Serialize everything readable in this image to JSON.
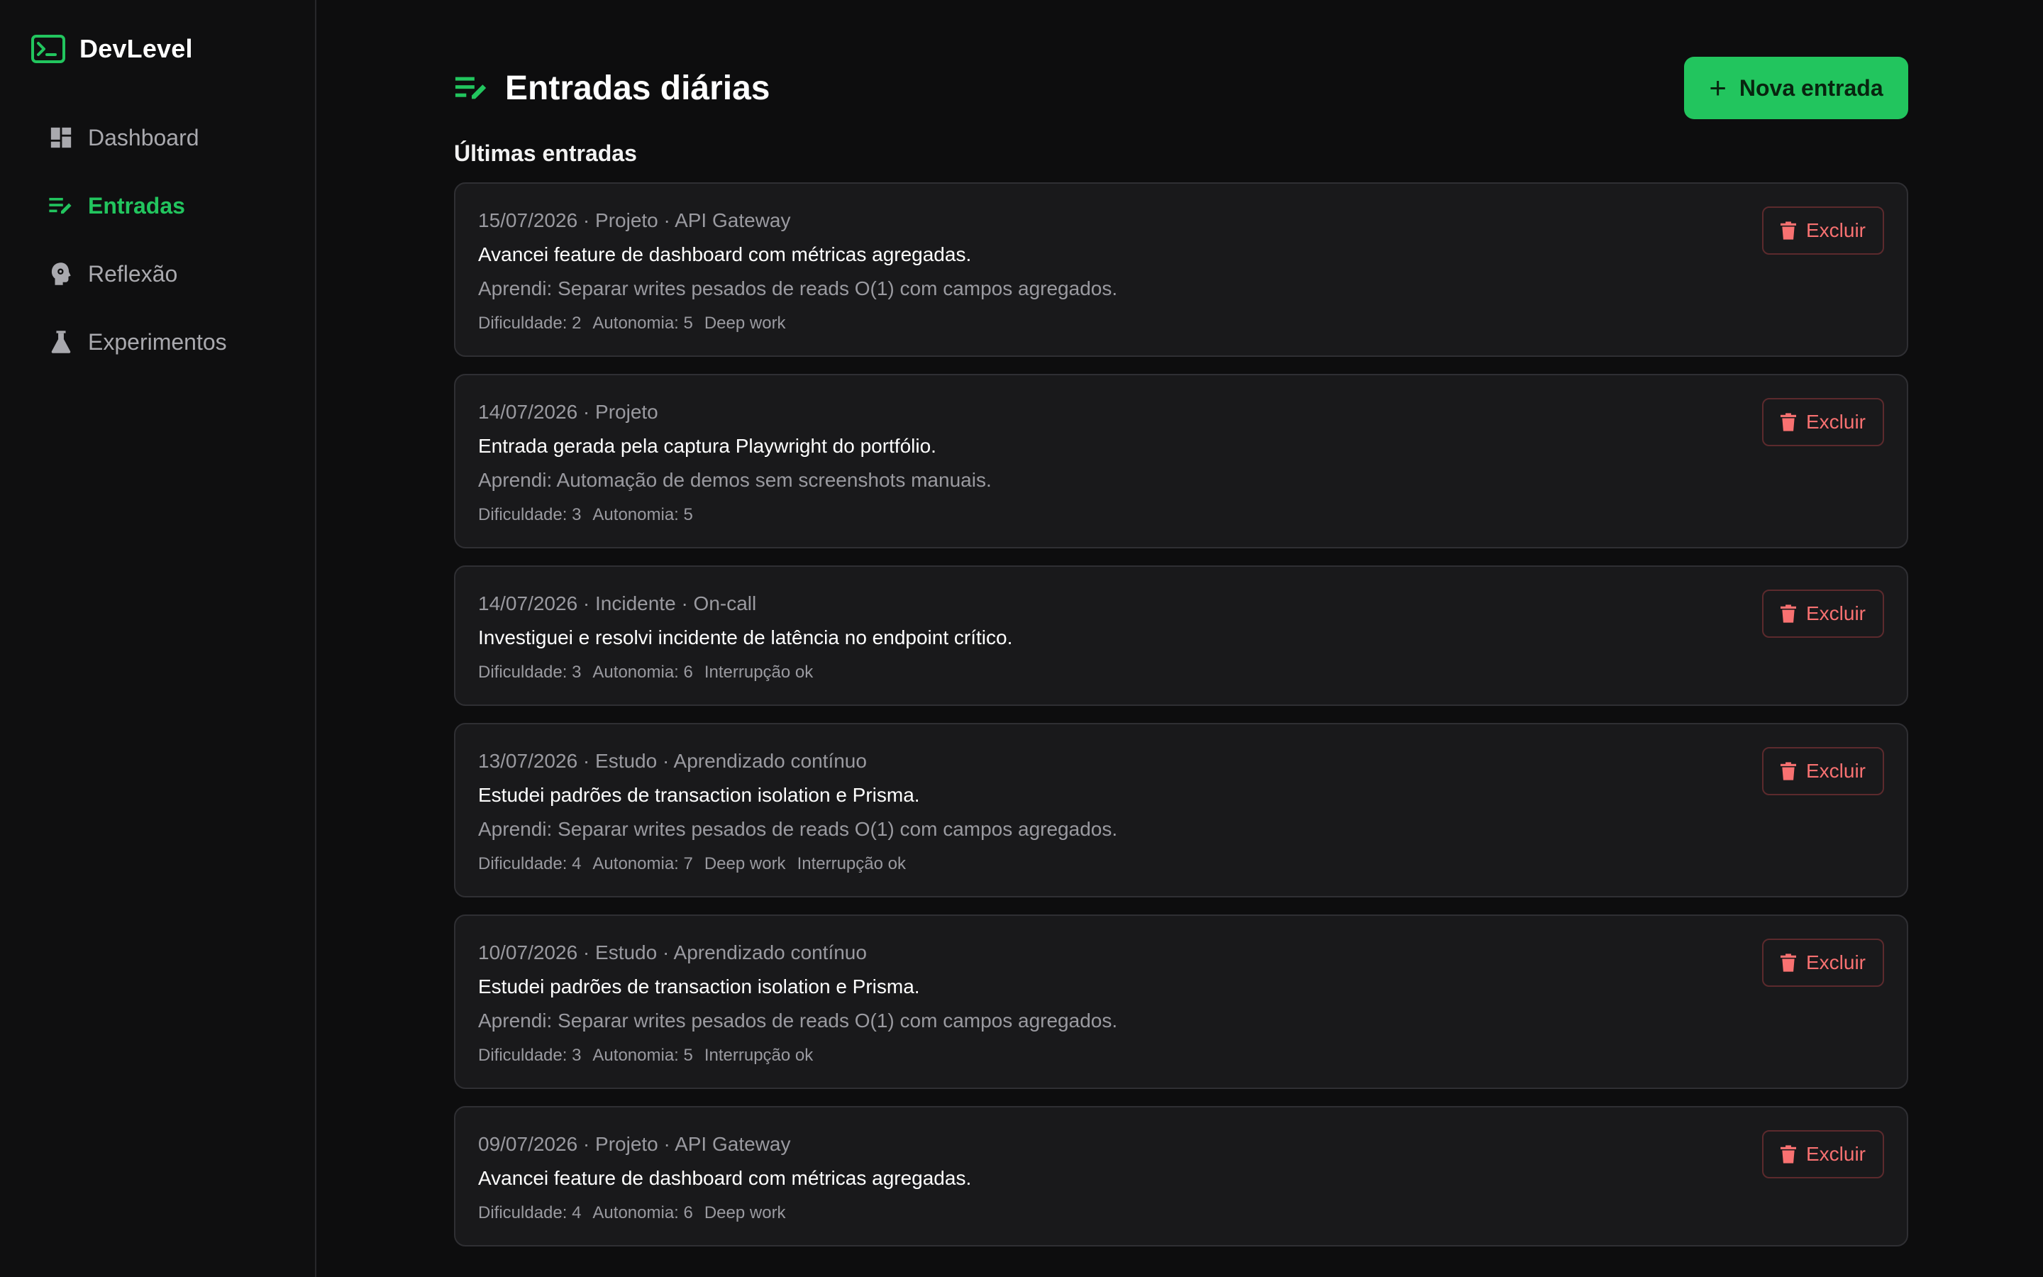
{
  "brand": {
    "name": "DevLevel",
    "icon": "terminal-icon",
    "accent": "#22c55e"
  },
  "nav": {
    "items": [
      {
        "label": "Dashboard",
        "icon": "dashboard-icon",
        "active": false
      },
      {
        "label": "Entradas",
        "icon": "edit-list-icon",
        "active": true
      },
      {
        "label": "Reflexão",
        "icon": "head-gear-icon",
        "active": false
      },
      {
        "label": "Experimentos",
        "icon": "flask-icon",
        "active": false
      }
    ]
  },
  "header": {
    "title": "Entradas diárias",
    "new_button": "Nova entrada"
  },
  "section_title": "Últimas entradas",
  "delete_label": "Excluir",
  "entries": [
    {
      "meta": "15/07/2026 · Projeto · API Gateway",
      "desc": "Avancei feature de dashboard com métricas agregadas.",
      "learned": "Aprendi: Separar writes pesados de reads O(1) com campos agregados.",
      "tags": [
        "Dificuldade: 2",
        "Autonomia: 5",
        "Deep work"
      ]
    },
    {
      "meta": "14/07/2026 · Projeto",
      "desc": "Entrada gerada pela captura Playwright do portfólio.",
      "learned": "Aprendi: Automação de demos sem screenshots manuais.",
      "tags": [
        "Dificuldade: 3",
        "Autonomia: 5"
      ]
    },
    {
      "meta": "14/07/2026 · Incidente · On-call",
      "desc": "Investiguei e resolvi incidente de latência no endpoint crítico.",
      "learned": null,
      "tags": [
        "Dificuldade: 3",
        "Autonomia: 6",
        "Interrupção ok"
      ]
    },
    {
      "meta": "13/07/2026 · Estudo · Aprendizado contínuo",
      "desc": "Estudei padrões de transaction isolation e Prisma.",
      "learned": "Aprendi: Separar writes pesados de reads O(1) com campos agregados.",
      "tags": [
        "Dificuldade: 4",
        "Autonomia: 7",
        "Deep work",
        "Interrupção ok"
      ]
    },
    {
      "meta": "10/07/2026 · Estudo · Aprendizado contínuo",
      "desc": "Estudei padrões de transaction isolation e Prisma.",
      "learned": "Aprendi: Separar writes pesados de reads O(1) com campos agregados.",
      "tags": [
        "Dificuldade: 3",
        "Autonomia: 5",
        "Interrupção ok"
      ]
    },
    {
      "meta": "09/07/2026 · Projeto · API Gateway",
      "desc": "Avancei feature de dashboard com métricas agregadas.",
      "learned": null,
      "tags": [
        "Dificuldade: 4",
        "Autonomia: 6",
        "Deep work"
      ]
    }
  ]
}
